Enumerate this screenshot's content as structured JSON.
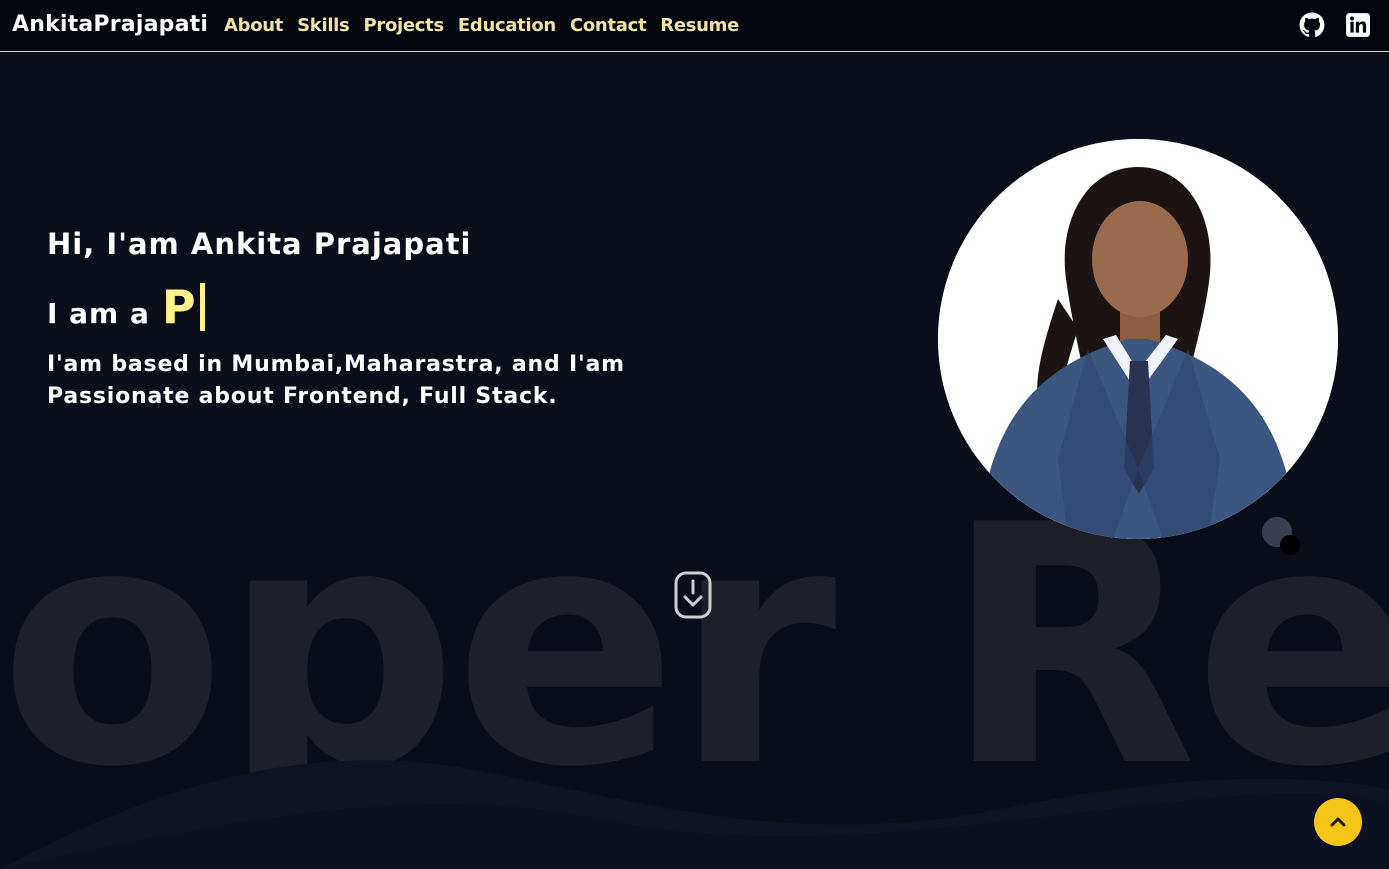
{
  "navbar": {
    "brand": "AnkitaPrajapati",
    "links": [
      {
        "label": "About"
      },
      {
        "label": "Skills"
      },
      {
        "label": "Projects"
      },
      {
        "label": "Education"
      },
      {
        "label": "Contact"
      },
      {
        "label": "Resume"
      }
    ],
    "social": [
      {
        "icon": "github-icon"
      },
      {
        "icon": "linkedin-icon"
      }
    ]
  },
  "hero": {
    "greeting": "Hi, I'am Ankita Prajapati",
    "typed_prefix": "I am a",
    "typed_text": "P",
    "about": "I'am based in Mumbai,Maharastra, and I'am Passionate about Frontend, Full Stack.",
    "background_word": "loper Rea"
  },
  "colors": {
    "background": "#0a0d1a",
    "navbar": "#03050d",
    "nav_link": "#f3e3a3",
    "accent": "#fff38a",
    "top_button": "#f5c518"
  },
  "icons": {
    "scroll": "scroll-down-icon",
    "back_to_top": "chevron-up-icon"
  }
}
